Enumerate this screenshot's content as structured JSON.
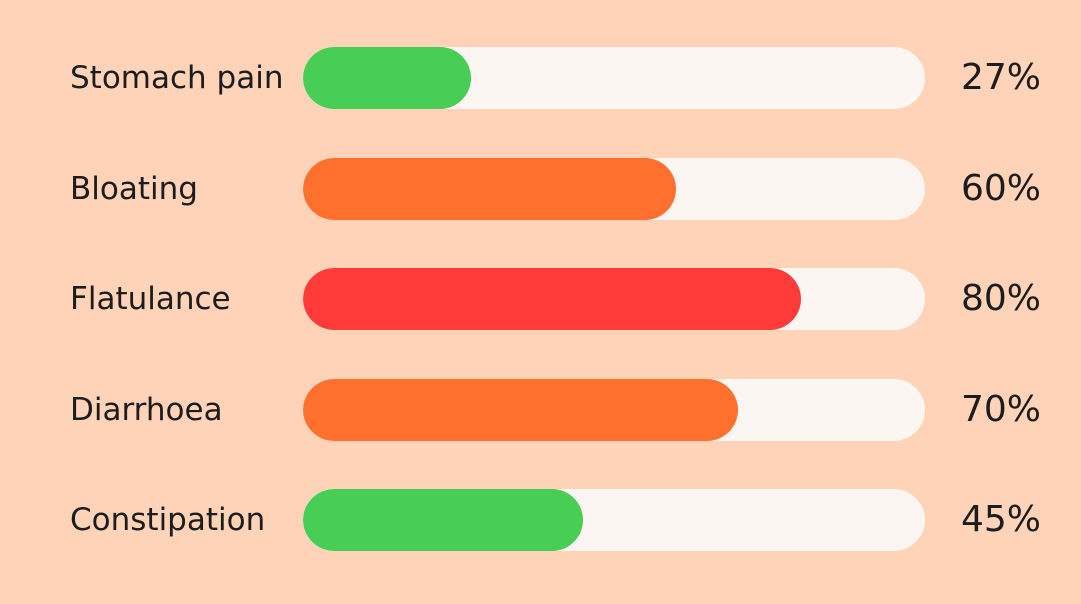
{
  "chart_data": {
    "type": "bar",
    "orientation": "horizontal",
    "categories": [
      "Stomach pain",
      "Bloating",
      "Flatulance",
      "Diarrhoea",
      "Constipation"
    ],
    "values": [
      27,
      60,
      80,
      70,
      45
    ],
    "value_labels": [
      "27%",
      "60%",
      "80%",
      "70%",
      "45%"
    ],
    "xlim": [
      0,
      100
    ],
    "grid": false,
    "legend": "none",
    "colors": [
      "#48CD55",
      "#FF6F2E",
      "#FF3B3A",
      "#FF6F2E",
      "#48CD55"
    ],
    "track_color": "#FBF6F2",
    "background_color": "#FFD3B8"
  }
}
